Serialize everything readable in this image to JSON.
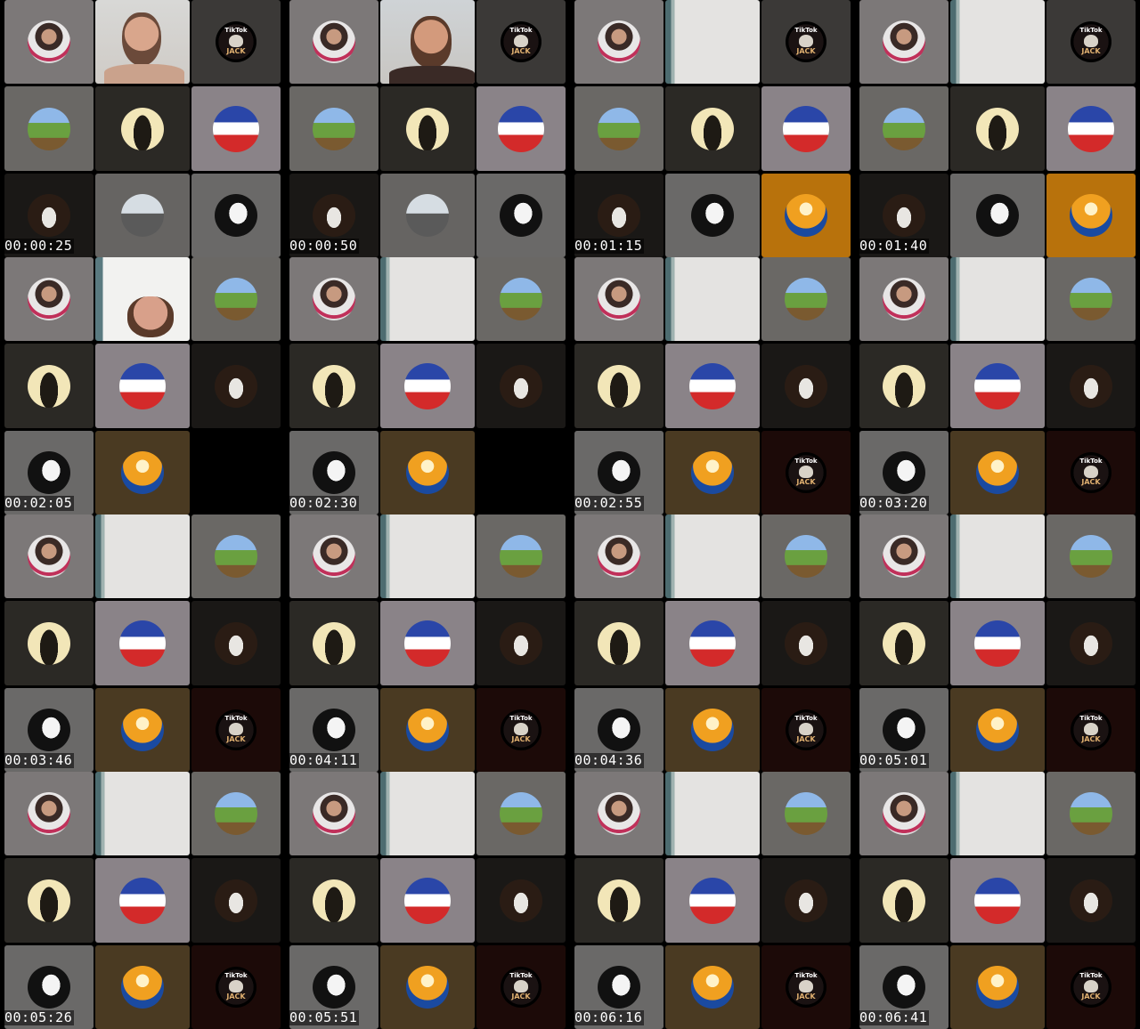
{
  "sheet": {
    "timestamps": [
      "00:00:25",
      "00:00:50",
      "00:01:15",
      "00:01:40",
      "00:02:05",
      "00:02:30",
      "00:02:55",
      "00:03:20",
      "00:03:46",
      "00:04:11",
      "00:04:36",
      "00:05:01",
      "00:05:26",
      "00:05:51",
      "00:06:16",
      "00:06:41"
    ]
  },
  "tiles": {
    "tiktok_logo_text": "TikTok",
    "tiktok_jack_text": "JACK"
  },
  "palette": {
    "tile_gray_light": "#7c7878",
    "tile_gray_mid": "#6a6865",
    "tile_dark": "#2b2925",
    "tile_darker": "#1a1816",
    "tile_lavender": "#8a8388",
    "tile_brown": "#4a3a22",
    "tile_orange": "#b8720c",
    "tile_maroon": "#1c0a08",
    "tile_white": "#e6e4e3",
    "flag_blue": "#2a46a8",
    "flag_red": "#d32a2a"
  },
  "frames": [
    {
      "tiles": [
        "woman",
        "webcam",
        "tiktok",
        "field",
        "warrior",
        "flag",
        "masked",
        "sky",
        "mj"
      ]
    },
    {
      "tiles": [
        "woman",
        "webcam2",
        "tiktok",
        "field",
        "warrior",
        "flag",
        "masked",
        "sky",
        "mj"
      ]
    },
    {
      "tiles": [
        "woman",
        "blank",
        "tiktok",
        "field",
        "warrior",
        "flag",
        "masked",
        "mj",
        "cowboy_orange"
      ]
    },
    {
      "tiles": [
        "woman",
        "blank",
        "tiktok",
        "field",
        "warrior",
        "flag",
        "masked",
        "mj",
        "cowboy_orange"
      ]
    },
    {
      "tiles": [
        "woman",
        "webcam3",
        "field",
        "warrior",
        "flag",
        "masked",
        "mj",
        "cowboy",
        "empty"
      ]
    },
    {
      "tiles": [
        "woman",
        "blank",
        "field",
        "warrior",
        "flag",
        "masked",
        "mj",
        "cowboy",
        "empty"
      ]
    },
    {
      "tiles": [
        "woman",
        "blank",
        "field",
        "warrior",
        "flag",
        "masked",
        "mj",
        "cowboy",
        "tiktok_dark"
      ]
    },
    {
      "tiles": [
        "woman",
        "blank",
        "field",
        "warrior",
        "flag",
        "masked",
        "mj",
        "cowboy",
        "tiktok_dark"
      ]
    },
    {
      "tiles": [
        "woman",
        "blank",
        "field",
        "warrior",
        "flag",
        "masked",
        "mj",
        "cowboy",
        "tiktok_dark"
      ]
    },
    {
      "tiles": [
        "woman",
        "blank",
        "field",
        "warrior",
        "flag",
        "masked",
        "mj",
        "cowboy",
        "tiktok_dark"
      ]
    },
    {
      "tiles": [
        "woman",
        "blank",
        "field",
        "warrior",
        "flag",
        "masked",
        "mj",
        "cowboy",
        "tiktok_dark"
      ]
    },
    {
      "tiles": [
        "woman",
        "blank",
        "field",
        "warrior",
        "flag",
        "masked",
        "mj",
        "cowboy",
        "tiktok_dark"
      ]
    },
    {
      "tiles": [
        "woman",
        "blank",
        "field",
        "warrior",
        "flag",
        "masked",
        "mj",
        "cowboy",
        "tiktok_dark"
      ]
    },
    {
      "tiles": [
        "woman",
        "blank",
        "field",
        "warrior",
        "flag",
        "masked",
        "mj",
        "cowboy",
        "tiktok_dark"
      ]
    },
    {
      "tiles": [
        "woman",
        "blank",
        "field",
        "warrior",
        "flag",
        "masked",
        "mj",
        "cowboy",
        "tiktok_dark"
      ]
    },
    {
      "tiles": [
        "woman",
        "blank",
        "field",
        "warrior",
        "flag",
        "masked",
        "mj",
        "cowboy",
        "tiktok_dark"
      ]
    }
  ]
}
